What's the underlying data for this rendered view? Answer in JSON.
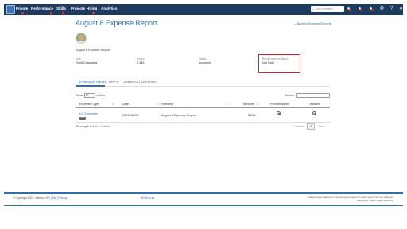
{
  "nav": {
    "items": [
      {
        "label": "Private"
      },
      {
        "label": "Performance"
      },
      {
        "label": "Skills"
      },
      {
        "label": "Projects"
      },
      {
        "label": "Hiring"
      },
      {
        "label": "Analytics"
      }
    ],
    "search_placeholder": "Ask or search"
  },
  "header": {
    "title": "August 8 Expense Report",
    "back_link": "← Back to Expense Reports",
    "subtitle": "August 8 Expense Report"
  },
  "fields": [
    {
      "label": "Date",
      "value": "Rohit Chaurasia"
    },
    {
      "label": "Amount",
      "value": "$ 345"
    },
    {
      "label": "Status",
      "value": "Approved"
    },
    {
      "label": "Reimbursement Status",
      "value": "Not Paid"
    }
  ],
  "tabs": [
    {
      "label": "EXPENSE ITEMS"
    },
    {
      "label": "DOCS"
    },
    {
      "label": "APPROVAL HISTORY"
    }
  ],
  "table": {
    "show_prefix": "Show",
    "show_value": "10",
    "show_suffix": "entries",
    "search_label": "Search:",
    "headers": [
      "Expense Type",
      "Date",
      "Remarks",
      "Amount",
      "Reimbursable",
      "Billable"
    ],
    "rows": [
      {
        "type": "DC Expenses",
        "tag": "INR",
        "date": "2021-08-01",
        "remarks": "August 8 Expense Report",
        "amount": "$ 345"
      }
    ],
    "showing": "Showing 1 to 1 of 1 entries",
    "prev": "Previous",
    "page": "1",
    "next": "Next"
  },
  "footer": {
    "copyright": "© Copyright 2021, Bamboo HR",
    "link1": "Tail",
    "link2": "Privacy",
    "center_link": "SIGN IN as",
    "right_text": "Change doesn't always run. Sometimes courage is the quiet voice at the end of the day whispering, 'I will try again tomorrow.'"
  },
  "colors": {
    "nav_bg": "#1f3a5f",
    "accent": "#2f6fb0",
    "highlight": "#e02020"
  }
}
